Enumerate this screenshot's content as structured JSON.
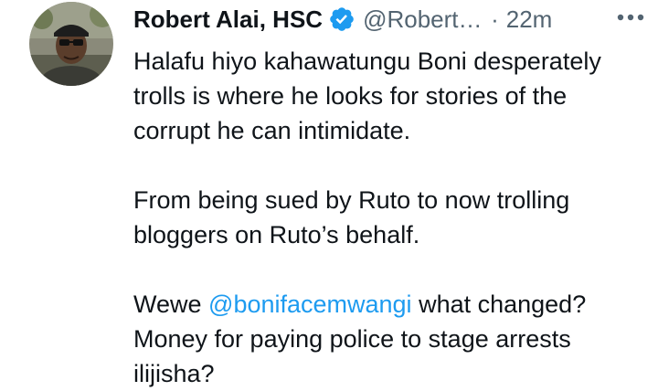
{
  "tweet": {
    "author": {
      "display_name": "Robert Alai, HSC",
      "handle": "@Robert",
      "handle_ellipsis": "…",
      "verified": true,
      "avatar_icon": "profile-photo"
    },
    "separator": "·",
    "timestamp": "22m",
    "more_icon": "more-options-icon",
    "paragraphs": {
      "p1": "Halafu hiyo kahawatungu Boni desperately trolls is where he looks for stories of the corrupt he can intimidate.",
      "p2": "From being sued by Ruto to now trolling bloggers on Ruto’s behalf.",
      "p3_prefix": "Wewe ",
      "p3_mention": "@bonifacemwangi",
      "p3_suffix": " what changed? Money for paying police to stage arrests ilijisha?"
    },
    "colors": {
      "text": "#0f1419",
      "secondary": "#536471",
      "accent": "#1d9bf0"
    }
  }
}
